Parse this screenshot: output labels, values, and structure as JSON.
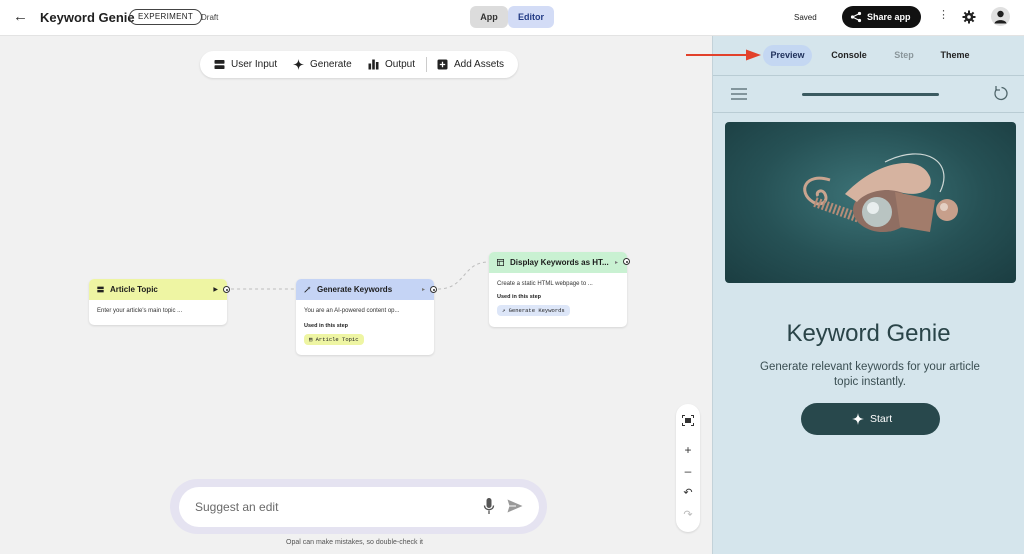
{
  "header": {
    "back_icon": "arrow-back-icon",
    "app_title": "Keyword Genie",
    "badge": "EXPERIMENT",
    "status": "Draft",
    "mode_tabs": [
      "App",
      "Editor"
    ],
    "active_mode": "Editor",
    "save_status": "Saved",
    "share_label": "Share app",
    "share_icon": "share-icon",
    "more_icon": "more-vert-icon",
    "settings_icon": "gear-icon",
    "account_icon": "avatar-icon"
  },
  "toolbar": {
    "items": [
      {
        "label": "User Input",
        "icon": "user-input-icon"
      },
      {
        "label": "Generate",
        "icon": "sparkle-icon"
      },
      {
        "label": "Output",
        "icon": "output-icon"
      },
      {
        "label": "Add Assets",
        "icon": "add-box-icon"
      }
    ]
  },
  "nodes": [
    {
      "title": "Article Topic",
      "body": "Enter your article's main topic ...",
      "color": "#eef5a3",
      "icon": "user-input-icon"
    },
    {
      "title": "Generate Keywords",
      "body": "You are an AI-powered content op...",
      "color": "#c5d4f5",
      "icon": "generate-icon",
      "used_label": "Used in this step",
      "chip": "Article Topic",
      "chip_color": "#eef5a3"
    },
    {
      "title": "Display Keywords as HT...",
      "body": "Create a static HTML webpage to ...",
      "color": "#c9f1d2",
      "icon": "web-output-icon",
      "used_label": "Used in this step",
      "chip": "Generate Keywords",
      "chip_color": "#dde6f8"
    }
  ],
  "zoom_controls": [
    "fit-view-icon",
    "zoom-in-icon",
    "zoom-out-icon",
    "undo-icon",
    "redo-icon"
  ],
  "suggest": {
    "placeholder": "Suggest an edit",
    "mic_icon": "mic-icon",
    "send_icon": "send-icon",
    "disclaimer": "Opal can make mistakes, so double-check it"
  },
  "preview_panel": {
    "tabs": [
      "Preview",
      "Console",
      "Step",
      "Theme"
    ],
    "active_tab": "Preview",
    "disabled_tab": "Step",
    "menu_icon": "menu-icon",
    "refresh_icon": "refresh-icon",
    "app_title": "Keyword Genie",
    "description": "Generate relevant keywords for your article topic instantly.",
    "start_label": "Start",
    "start_icon": "sparkle-icon"
  },
  "annotation": {
    "arrow_color": "#e2412b"
  },
  "colors": {
    "editor_tab_bg": "#d3dcf6",
    "panel_bg": "#d5e5ec",
    "start_button_bg": "#28484c",
    "suggest_outer_bg": "#e5e3f1"
  }
}
